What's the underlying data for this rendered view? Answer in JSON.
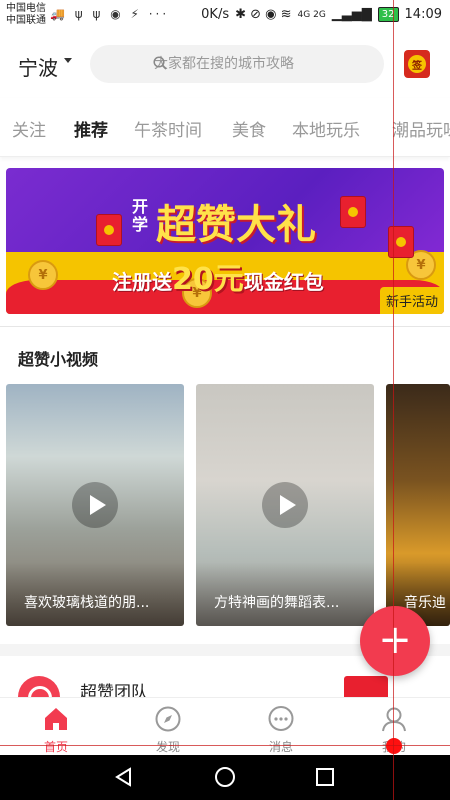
{
  "status_bar": {
    "carrier_1": "中国电信",
    "carrier_2": "中国联通",
    "left_icons": "🚚 ψ ψ ◉ ⚡ ···",
    "net_speed": "0K/s",
    "signal_text": "4G 2G",
    "battery": "32",
    "time": "14:09"
  },
  "header": {
    "city": "宁波",
    "search_placeholder": "大家都在搜的城市攻略",
    "sign_label": "签"
  },
  "tabs": [
    {
      "label": "关注",
      "active": false
    },
    {
      "label": "推荐",
      "active": true
    },
    {
      "label": "午茶时间",
      "active": false
    },
    {
      "label": "美食",
      "active": false
    },
    {
      "label": "本地玩乐",
      "active": false
    },
    {
      "label": "潮品玩味",
      "active": false
    }
  ],
  "banner": {
    "kai_xue": "开学",
    "title": "超赞大礼",
    "sub_prefix": "注册送",
    "amount": "20元",
    "sub_suffix": "现金红包",
    "badge": "新手活动",
    "coin_glyph": "¥"
  },
  "videos_section": {
    "title": "超赞小视频",
    "videos": [
      {
        "caption": "喜欢玻璃栈道的朋..."
      },
      {
        "caption": "方特神画的舞蹈表..."
      },
      {
        "caption": "音乐迪"
      }
    ]
  },
  "team": {
    "name": "超赞团队"
  },
  "fab": {
    "label": "+"
  },
  "bottom_nav": [
    {
      "label": "首页",
      "icon": "home-icon",
      "active": true
    },
    {
      "label": "发现",
      "icon": "compass-icon",
      "active": false
    },
    {
      "label": "消息",
      "icon": "chat-icon",
      "active": false
    },
    {
      "label": "我的",
      "icon": "user-icon",
      "active": false
    }
  ],
  "colors": {
    "accent": "#f23b4f",
    "banner_purple": "#6a26c8",
    "banner_yellow": "#f5c400",
    "banner_red": "#e8202f"
  }
}
